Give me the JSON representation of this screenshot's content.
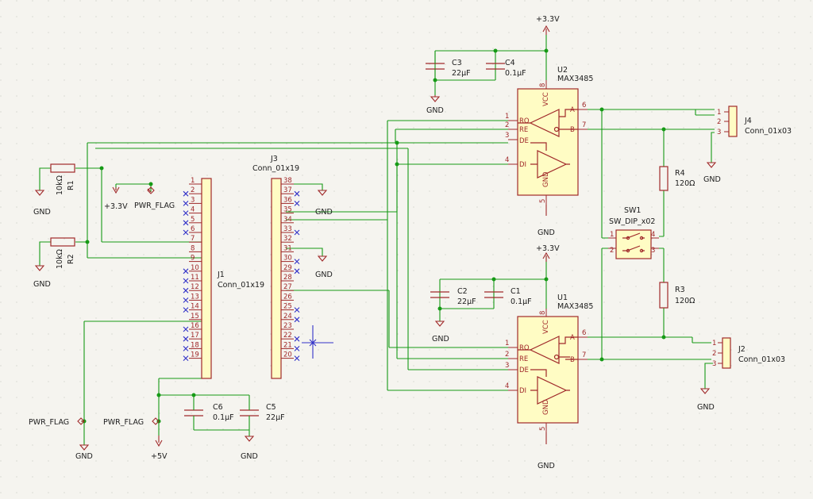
{
  "power": {
    "v33_top": "+3.3V",
    "v33_mid": "+3.3V",
    "v33_left": "+3.3V",
    "v5": "+5V",
    "gnd": "GND",
    "pwr_flag": "PWR_FLAG"
  },
  "components": {
    "u2": {
      "ref": "U2",
      "value": "MAX3485"
    },
    "u1": {
      "ref": "U1",
      "value": "MAX3485"
    },
    "j1": {
      "ref": "J1",
      "value": "Conn_01x19"
    },
    "j2": {
      "ref": "J2",
      "value": "Conn_01x03"
    },
    "j3": {
      "ref": "J3",
      "value": "Conn_01x19"
    },
    "j4": {
      "ref": "J4",
      "value": "Conn_01x03"
    },
    "r1": {
      "ref": "R1",
      "value": "10kΩ"
    },
    "r2": {
      "ref": "R2",
      "value": "10kΩ"
    },
    "r3": {
      "ref": "R3",
      "value": "120Ω"
    },
    "r4": {
      "ref": "R4",
      "value": "120Ω"
    },
    "c1": {
      "ref": "C1",
      "value": "0.1µF"
    },
    "c2": {
      "ref": "C2",
      "value": "22µF"
    },
    "c3": {
      "ref": "C3",
      "value": "22µF"
    },
    "c4": {
      "ref": "C4",
      "value": "0.1µF"
    },
    "c5": {
      "ref": "C5",
      "value": "22µF"
    },
    "c6": {
      "ref": "C6",
      "value": "0.1µF"
    },
    "sw1": {
      "ref": "SW1",
      "value": "SW_DIP_x02"
    }
  },
  "ic_pins": {
    "ro": "RO",
    "re": "RE",
    "de": "DE",
    "di": "DI",
    "a": "A",
    "b": "B",
    "vcc": "VCC",
    "gnd": "GND",
    "n1": "1",
    "n2": "2",
    "n3": "3",
    "n4": "4",
    "n5": "5",
    "n6": "6",
    "n7": "7",
    "n8": "8"
  },
  "conn3_pins": [
    "1",
    "2",
    "3"
  ],
  "sw_pins": [
    "1",
    "2",
    "3",
    "4"
  ],
  "j1_pins": [
    "1",
    "2",
    "3",
    "4",
    "5",
    "6",
    "7",
    "8",
    "9",
    "10",
    "11",
    "12",
    "13",
    "14",
    "15",
    "16",
    "17",
    "18",
    "19"
  ],
  "j3_pins": [
    "38",
    "37",
    "36",
    "35",
    "34",
    "33",
    "32",
    "31",
    "30",
    "29",
    "28",
    "27",
    "26",
    "25",
    "24",
    "23",
    "22",
    "21",
    "20"
  ]
}
